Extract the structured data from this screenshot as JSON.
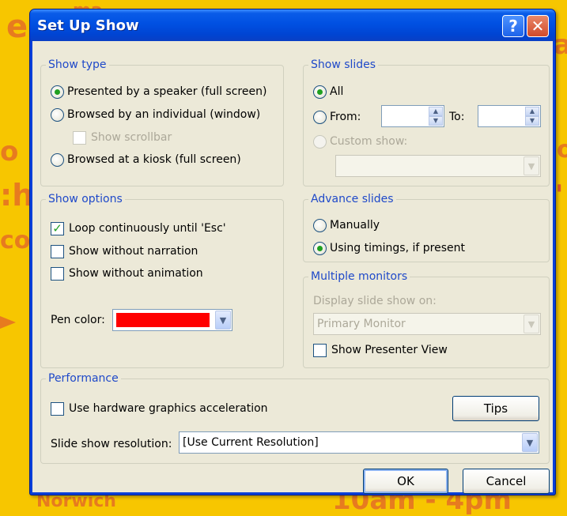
{
  "window": {
    "title": "Set Up Show",
    "help_label": "?",
    "close_label": "✕"
  },
  "background": {
    "bottom_left_text": "Norwich",
    "bottom_right_text": "10am - 4pm"
  },
  "show_type": {
    "legend": "Show type",
    "options": [
      {
        "label": "Presented by a speaker (full screen)",
        "selected": true
      },
      {
        "label": "Browsed by an individual (window)",
        "selected": false
      },
      {
        "label": "Browsed at a kiosk (full screen)",
        "selected": false
      }
    ],
    "scrollbar_label": "Show scrollbar"
  },
  "show_slides": {
    "legend": "Show slides",
    "all_label": "All",
    "from_label": "From:",
    "to_label": "To:",
    "from_value": "",
    "to_value": "",
    "custom_label": "Custom show:",
    "custom_value": ""
  },
  "show_options": {
    "legend": "Show options",
    "loop_label": "Loop continuously until 'Esc'",
    "narration_label": "Show without narration",
    "animation_label": "Show without animation",
    "pen_label": "Pen color:",
    "pen_color": "#ff0000"
  },
  "advance": {
    "legend": "Advance slides",
    "manually_label": "Manually",
    "timings_label": "Using timings, if present"
  },
  "monitors": {
    "legend": "Multiple monitors",
    "display_label": "Display slide show on:",
    "display_value": "Primary Monitor",
    "presenter_label": "Show Presenter View"
  },
  "performance": {
    "legend": "Performance",
    "hardware_label": "Use hardware graphics acceleration",
    "tips_label": "Tips",
    "resolution_label": "Slide show resolution:",
    "resolution_value": "[Use Current Resolution]"
  },
  "buttons": {
    "ok": "OK",
    "cancel": "Cancel"
  },
  "icons": {
    "chevron": "▼",
    "spin_up": "▲",
    "spin_down": "▼",
    "check": "✓"
  }
}
